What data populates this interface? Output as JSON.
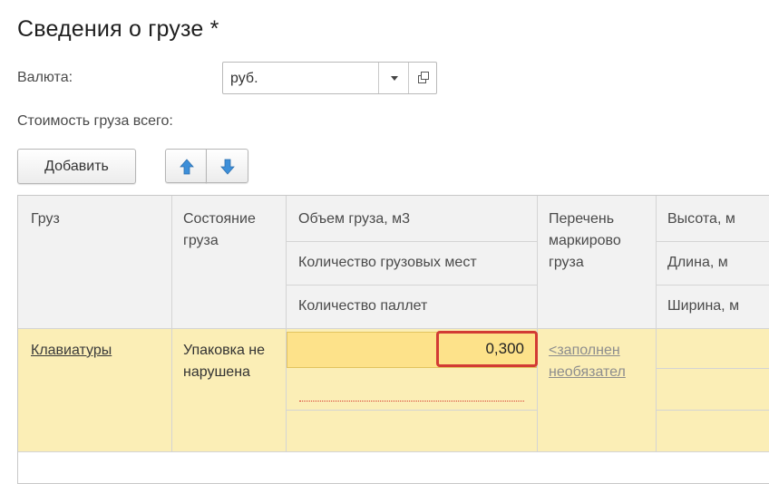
{
  "form": {
    "title": "Сведения о грузе *"
  },
  "currency": {
    "label": "Валюта:",
    "value": "руб."
  },
  "total_cost": {
    "label": "Стоимость груза всего:"
  },
  "toolbar": {
    "add_label": "Добавить"
  },
  "table": {
    "columns": {
      "cargo": "Груз",
      "state": "Состояние груза",
      "volume": "Объем груза, м3",
      "places": "Количество грузовых мест",
      "pallets": "Количество паллет",
      "marking": "Перечень маркирово груза",
      "height": "Высота, м",
      "length": "Длина, м",
      "width": "Ширина, м"
    },
    "rows": [
      {
        "cargo": "Клавиатуры",
        "state": "Упаковка не нарушена",
        "volume": "0,300",
        "marking": "<заполнен необязател"
      }
    ]
  },
  "colors": {
    "selected_row": "#fbeeb6",
    "edit_cell": "#fde28a",
    "error_border": "#d23b34"
  }
}
